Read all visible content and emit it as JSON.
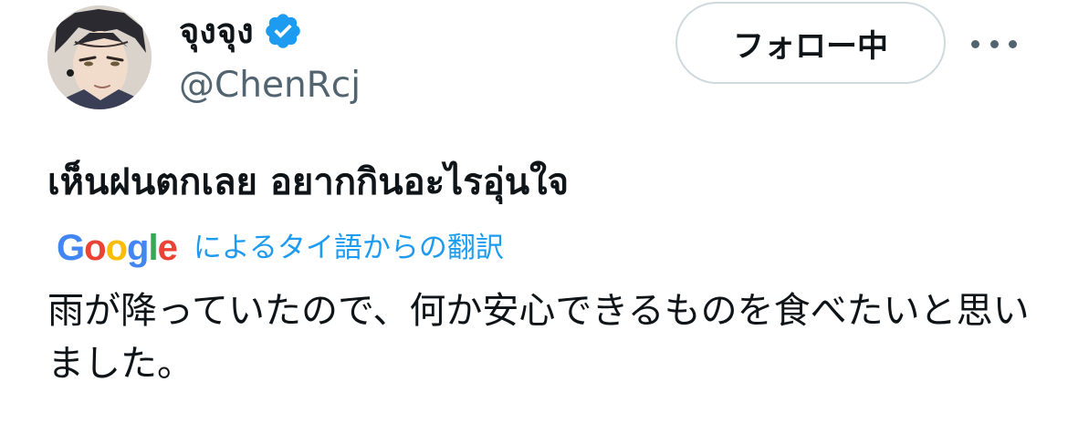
{
  "author": {
    "display_name": "จุงจุง",
    "handle": "@ChenRcj",
    "verified": true,
    "avatar_icon": "anime-character-avatar"
  },
  "actions": {
    "follow_label": "フォロー中",
    "more_icon": "more-horizontal-icon"
  },
  "tweet": {
    "text": "เห็นฝนตกเลย อยากกินอะไรอุ่นใจ"
  },
  "translation": {
    "provider_logo": [
      "G",
      "o",
      "o",
      "g",
      "l",
      "e"
    ],
    "label": "によるタイ語からの翻訳",
    "text": "雨が降っていたので、何か安心できるものを食べたいと思いました。"
  },
  "colors": {
    "verified_blue": "#1d9bf0",
    "link_blue": "#1d9bf0",
    "secondary_text": "#536471",
    "google_blue": "#4285f4",
    "google_red": "#ea4335",
    "google_yellow": "#fbbc05",
    "google_green": "#34a853"
  }
}
